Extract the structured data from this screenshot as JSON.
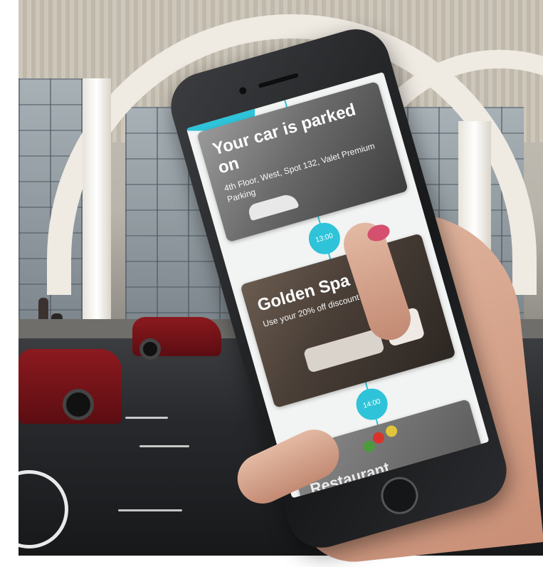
{
  "app": {
    "cards": [
      {
        "title": "Your car is parked on",
        "subtitle": "4th Floor, West, Spot 132, Valet Premium Parking"
      },
      {
        "title": "Golden Spa",
        "subtitle": "Use your 20% off discount"
      },
      {
        "title": "Restaurant",
        "subtitle": ""
      }
    ],
    "timeline": [
      {
        "time": "13:00"
      },
      {
        "time": "14:00"
      }
    ]
  },
  "colors": {
    "accent": "#2ec3d8",
    "nail": "#d5506e",
    "taxi": "#8c1a1f"
  }
}
